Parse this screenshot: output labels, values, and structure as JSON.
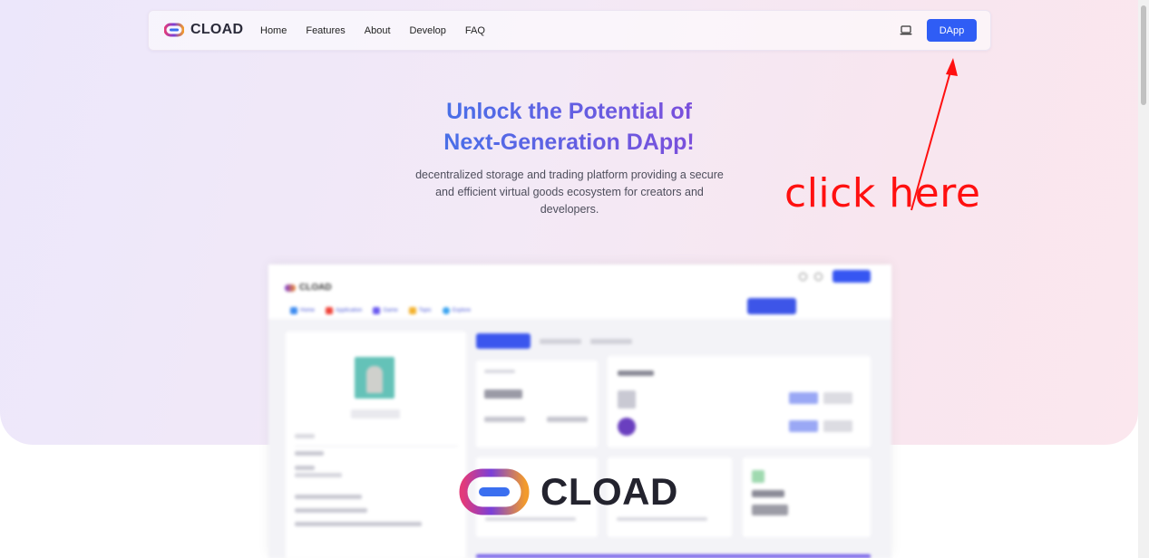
{
  "brand": {
    "name": "CLOAD"
  },
  "nav": {
    "links": [
      "Home",
      "Features",
      "About",
      "Develop",
      "FAQ"
    ],
    "dapp_button": "DApp"
  },
  "hero": {
    "headline_line1": "Unlock the Potential of",
    "headline_line2": "Next-Generation DApp!",
    "subtitle": "decentralized storage and trading platform providing a secure and efficient virtual goods ecosystem for creators and developers."
  },
  "annotation": {
    "text": "click here",
    "color": "#ff1010"
  },
  "preview": {
    "brand": "CLOAD",
    "tabs": [
      "Home",
      "Application",
      "Game",
      "Topic",
      "Explore"
    ]
  },
  "overlay_logo": {
    "text": "CLOAD"
  },
  "colors": {
    "primary": "#2f5df5",
    "gradient_start": "#16a38a",
    "gradient_mid": "#4b6ee8",
    "gradient_end": "#cf3e86"
  },
  "icons": {
    "laptop": "laptop-icon",
    "logo": "cload-logo-icon"
  }
}
